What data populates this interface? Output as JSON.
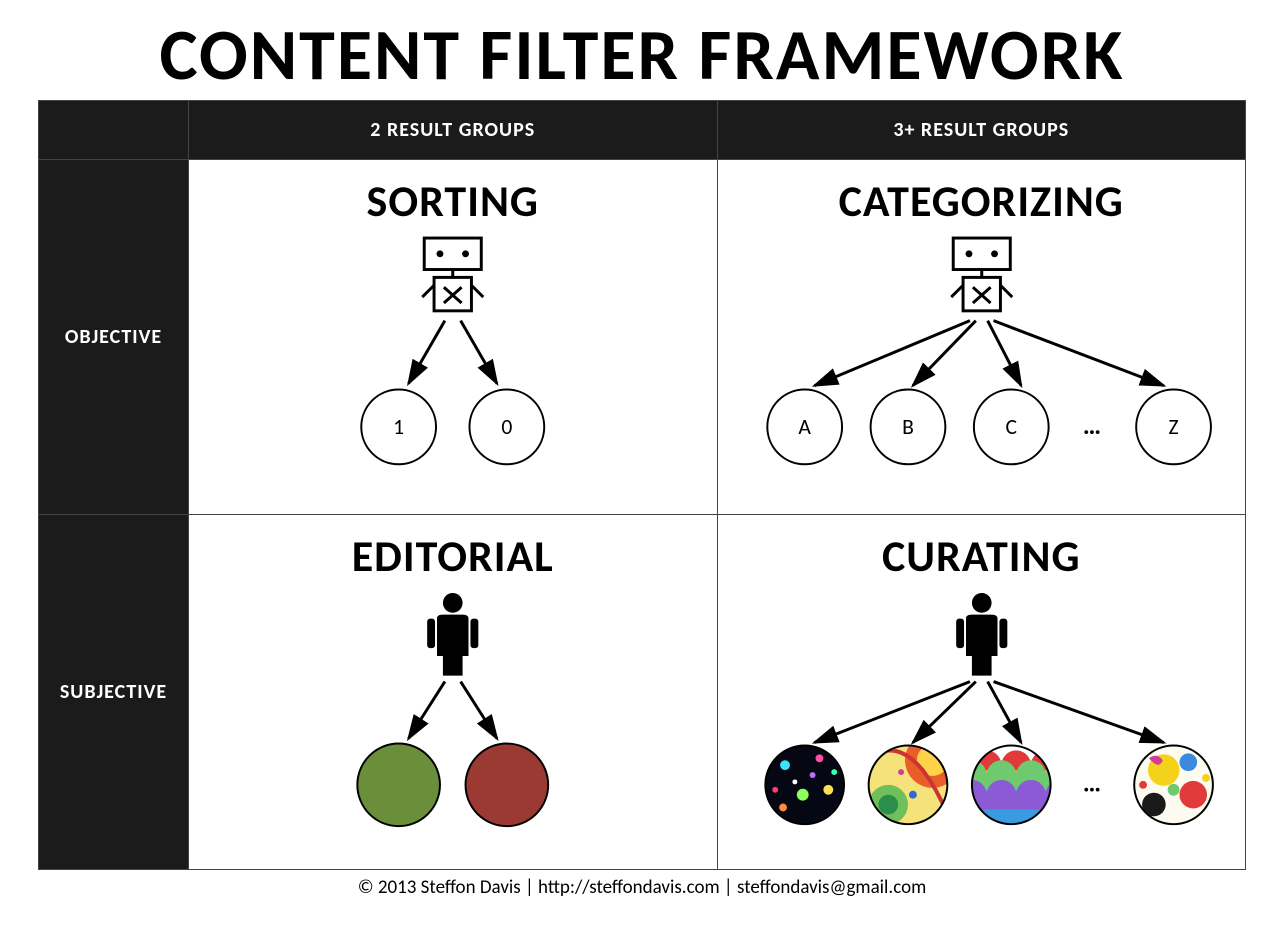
{
  "title": "CONTENT FILTER FRAMEWORK",
  "columns": {
    "col1": "2 RESULT GROUPS",
    "col2": "3+ RESULT GROUPS"
  },
  "rows": {
    "row1": "OBJECTIVE",
    "row2": "SUBJECTIVE"
  },
  "cells": {
    "sorting": {
      "title": "SORTING",
      "nodes": {
        "a": "1",
        "b": "0"
      }
    },
    "categorizing": {
      "title": "CATEGORIZING",
      "nodes": {
        "a": "A",
        "b": "B",
        "c": "C",
        "d": "Z",
        "ellipsis": "…"
      }
    },
    "editorial": {
      "title": "EDITORIAL",
      "colors": {
        "a": "#6b8e3a",
        "b": "#9b3a33"
      }
    },
    "curating": {
      "title": "CURATING",
      "ellipsis": "…"
    }
  },
  "footer": "© 2013 Steffon Davis | http://steffondavis.com | steffondavis@gmail.com"
}
